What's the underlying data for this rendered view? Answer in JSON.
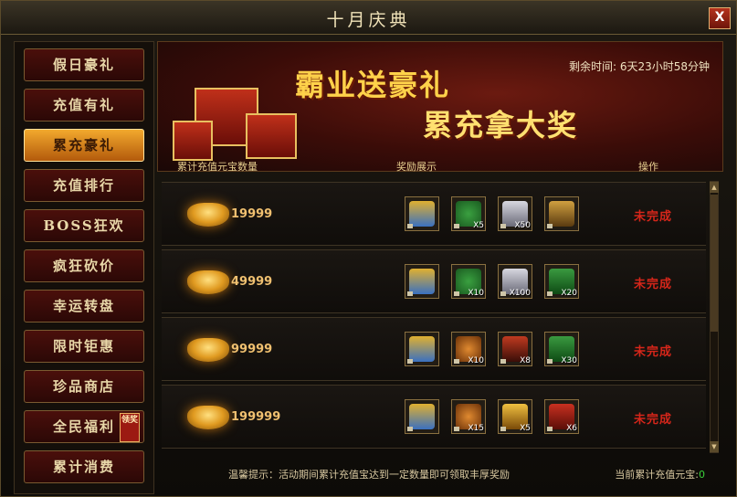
{
  "window": {
    "title": "十月庆典",
    "close_label": "X"
  },
  "sidebar": {
    "items": [
      {
        "label": "假日豪礼",
        "active": false
      },
      {
        "label": "充值有礼",
        "active": false
      },
      {
        "label": "累充豪礼",
        "active": true
      },
      {
        "label": "充值排行",
        "active": false
      },
      {
        "label": "BOSS狂欢",
        "active": false
      },
      {
        "label": "疯狂砍价",
        "active": false
      },
      {
        "label": "幸运转盘",
        "active": false
      },
      {
        "label": "限时钜惠",
        "active": false
      },
      {
        "label": "珍品商店",
        "active": false
      },
      {
        "label": "全民福利",
        "active": false,
        "badge": "领奖"
      },
      {
        "label": "累计消费",
        "active": false
      }
    ]
  },
  "banner": {
    "slogan_line1": "霸业送豪礼",
    "slogan_line2": "累充拿大奖",
    "remaining_label": "剩余时间:",
    "remaining_value": "6天23小时58分钟"
  },
  "columns": {
    "amount": "累计充值元宝数量",
    "rewards": "奖励展示",
    "action": "操作"
  },
  "rows": [
    {
      "amount": "19999",
      "status": "未完成",
      "items": [
        {
          "icon": "gift-box-icon",
          "qty": ""
        },
        {
          "icon": "money-bag-icon",
          "qty": "X5"
        },
        {
          "icon": "crystal-ore-icon",
          "qty": "X50"
        },
        {
          "icon": "treasure-chest-icon",
          "qty": ""
        }
      ]
    },
    {
      "amount": "49999",
      "status": "未完成",
      "items": [
        {
          "icon": "gift-box-icon",
          "qty": ""
        },
        {
          "icon": "money-bag-icon",
          "qty": "X10"
        },
        {
          "icon": "crystal-ore-icon",
          "qty": "X100"
        },
        {
          "icon": "green-book-icon",
          "qty": "X20"
        }
      ]
    },
    {
      "amount": "99999",
      "status": "未完成",
      "items": [
        {
          "icon": "gift-box-icon",
          "qty": ""
        },
        {
          "icon": "money-bag-icon",
          "qty": "X10"
        },
        {
          "icon": "red-chest-icon",
          "qty": "X8"
        },
        {
          "icon": "green-book-icon",
          "qty": "X30"
        }
      ]
    },
    {
      "amount": "199999",
      "status": "未完成",
      "items": [
        {
          "icon": "gift-box-icon",
          "qty": ""
        },
        {
          "icon": "money-bag-icon",
          "qty": "X15"
        },
        {
          "icon": "gold-chest-icon",
          "qty": "X5"
        },
        {
          "icon": "red-book-icon",
          "qty": "X6"
        }
      ]
    }
  ],
  "footer": {
    "tip": "温馨提示：活动期间累计充值宝达到一定数量即可领取丰厚奖励",
    "total_label": "当前累计充值元宝:",
    "total_value": "0"
  },
  "colors": {
    "accent_gold": "#f2a92e",
    "status_red": "#d6261a",
    "total_green": "#3ad23a"
  }
}
